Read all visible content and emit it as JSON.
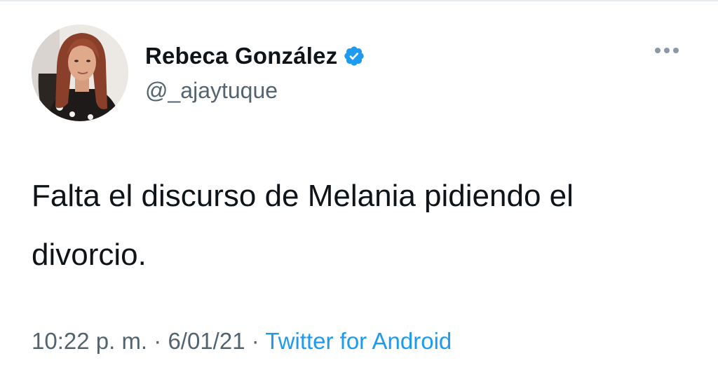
{
  "author": {
    "display_name": "Rebeca González",
    "handle": "@_ajaytuque",
    "verified": true
  },
  "tweet": {
    "text": "Falta el discurso de Melania pidiendo el divorcio.",
    "time": "10:22 p. m.",
    "separator": "·",
    "date": "6/01/21",
    "source": "Twitter for Android"
  },
  "icons": {
    "verified": "verified-badge-icon",
    "more": "more-dots-icon"
  },
  "colors": {
    "accent": "#1d9bf0",
    "secondary_text": "#536471",
    "primary_text": "#0f1419"
  }
}
